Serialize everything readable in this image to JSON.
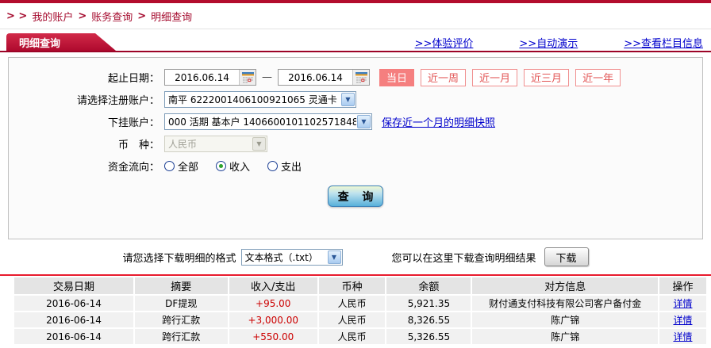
{
  "breadcrumb": {
    "prefix": "> >",
    "separator": ">",
    "items": [
      "我的账户",
      "账务查询",
      "明细查询"
    ]
  },
  "tab": {
    "label": "明细查询"
  },
  "top_links": [
    {
      "label": ">>体验评价"
    },
    {
      "label": ">>自动演示"
    },
    {
      "label": ">>查看栏目信息"
    }
  ],
  "form": {
    "date_row": {
      "label": "起止日期：",
      "start_date": "2016.06.14",
      "end_date": "2016.06.14",
      "dash": "—",
      "quick_buttons": [
        {
          "label": "当日",
          "selected": true
        },
        {
          "label": "近一周",
          "selected": false
        },
        {
          "label": "近一月",
          "selected": false
        },
        {
          "label": "近三月",
          "selected": false
        },
        {
          "label": "近一年",
          "selected": false
        }
      ]
    },
    "register_account": {
      "label": "请选择注册账户：",
      "value": "南平 6222001406100921065 灵通卡"
    },
    "sub_account": {
      "label": "下挂账户：",
      "value": "000 活期 基本户 1406600101102571848",
      "link": "保存近一个月的明细快照"
    },
    "currency": {
      "label": "币　种：",
      "value": "人民币",
      "disabled": true
    },
    "fund_flow": {
      "label": "资金流向：",
      "options": [
        {
          "label": "全部",
          "selected": false
        },
        {
          "label": "收入",
          "selected": true
        },
        {
          "label": "支出",
          "selected": false
        }
      ]
    },
    "query_button": "查 询"
  },
  "download": {
    "format_label": "请您选择下载明细的格式",
    "format_value": "文本格式（.txt）",
    "hint": "您可以在这里下载查询明细结果",
    "button": "下载"
  },
  "table": {
    "headers": [
      "交易日期",
      "摘要",
      "收入/支出",
      "币种",
      "余额",
      "对方信息",
      "操作"
    ],
    "rows": [
      {
        "date": "2016-06-14",
        "summary": "DF提现",
        "amount": "+95.00",
        "currency": "人民币",
        "balance": "5,921.35",
        "counterparty": "财付通支付科技有限公司客户备付金",
        "action": "详情"
      },
      {
        "date": "2016-06-14",
        "summary": "跨行汇款",
        "amount": "+3,000.00",
        "currency": "人民币",
        "balance": "8,326.55",
        "counterparty": "陈广锦",
        "action": "详情"
      },
      {
        "date": "2016-06-14",
        "summary": "跨行汇款",
        "amount": "+550.00",
        "currency": "人民币",
        "balance": "5,326.55",
        "counterparty": "陈广锦",
        "action": "详情"
      }
    ]
  },
  "colors": {
    "brand_red": "#b30d2e",
    "tab_red": "#af0a2e",
    "link_blue": "#0000cc",
    "amount_red": "#cc0000",
    "quick_button_red": "#f57f7f",
    "table_header_bg": "#e4e4e4",
    "table_row_bg": "#f1f1f1",
    "divider_red": "#e81b2d"
  }
}
